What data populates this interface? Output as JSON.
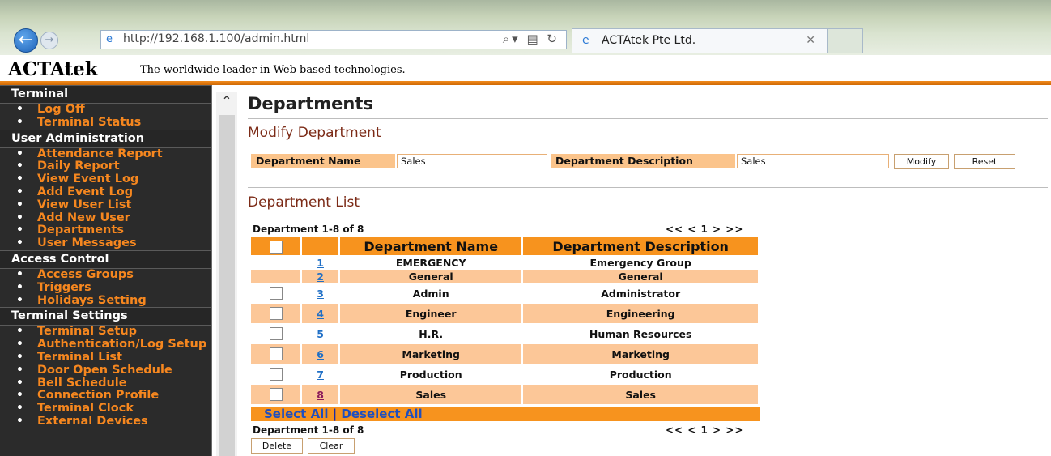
{
  "browser": {
    "url": "http://192.168.1.100/admin.html",
    "tab_title": "ACTAtek Pte Ltd."
  },
  "site": {
    "logo": "ACTAtek",
    "tagline": "The worldwide leader in Web based technologies."
  },
  "sidebar": {
    "sections": [
      {
        "title": "Terminal",
        "items": [
          "Log Off",
          "Terminal Status"
        ]
      },
      {
        "title": "User Administration",
        "items": [
          "Attendance Report",
          "Daily Report",
          "View Event Log",
          "Add Event Log",
          "View User List",
          "Add New User",
          "Departments",
          "User Messages"
        ]
      },
      {
        "title": "Access Control",
        "items": [
          "Access Groups",
          "Triggers",
          "Holidays Setting"
        ]
      },
      {
        "title": "Terminal Settings",
        "items": [
          "Terminal Setup",
          "Authentication/Log Setup",
          "Terminal List",
          "Door Open Schedule",
          "Bell Schedule",
          "Connection Profile",
          "Terminal Clock",
          "External Devices"
        ]
      }
    ]
  },
  "main": {
    "title": "Departments",
    "modify": {
      "heading": "Modify Department",
      "name_label": "Department Name",
      "name_value": "Sales",
      "desc_label": "Department Description",
      "desc_value": "Sales",
      "modify_btn": "Modify",
      "reset_btn": "Reset"
    },
    "list": {
      "heading": "Department List",
      "count_text": "Department 1-8 of 8",
      "pager": "<< < 1 > >>",
      "col_name": "Department Name",
      "col_desc": "Department Description",
      "rows": [
        {
          "num": "1",
          "name": "EMERGENCY",
          "desc": "Emergency Group"
        },
        {
          "num": "2",
          "name": "General",
          "desc": "General"
        },
        {
          "num": "3",
          "name": "Admin",
          "desc": "Administrator"
        },
        {
          "num": "4",
          "name": "Engineer",
          "desc": "Engineering"
        },
        {
          "num": "5",
          "name": "H.R.",
          "desc": "Human Resources"
        },
        {
          "num": "6",
          "name": "Marketing",
          "desc": "Marketing"
        },
        {
          "num": "7",
          "name": "Production",
          "desc": "Production"
        },
        {
          "num": "8",
          "name": "Sales",
          "desc": "Sales"
        }
      ],
      "select_all": "Select All",
      "separator": "|",
      "deselect_all": "Deselect All",
      "delete_btn": "Delete",
      "clear_btn": "Clear"
    }
  },
  "colors": {
    "accent_orange": "#f7931e",
    "row_highlight": "#fcc798",
    "sidebar_bg": "#2b2b2b",
    "link_blue": "#1f6fc6"
  }
}
